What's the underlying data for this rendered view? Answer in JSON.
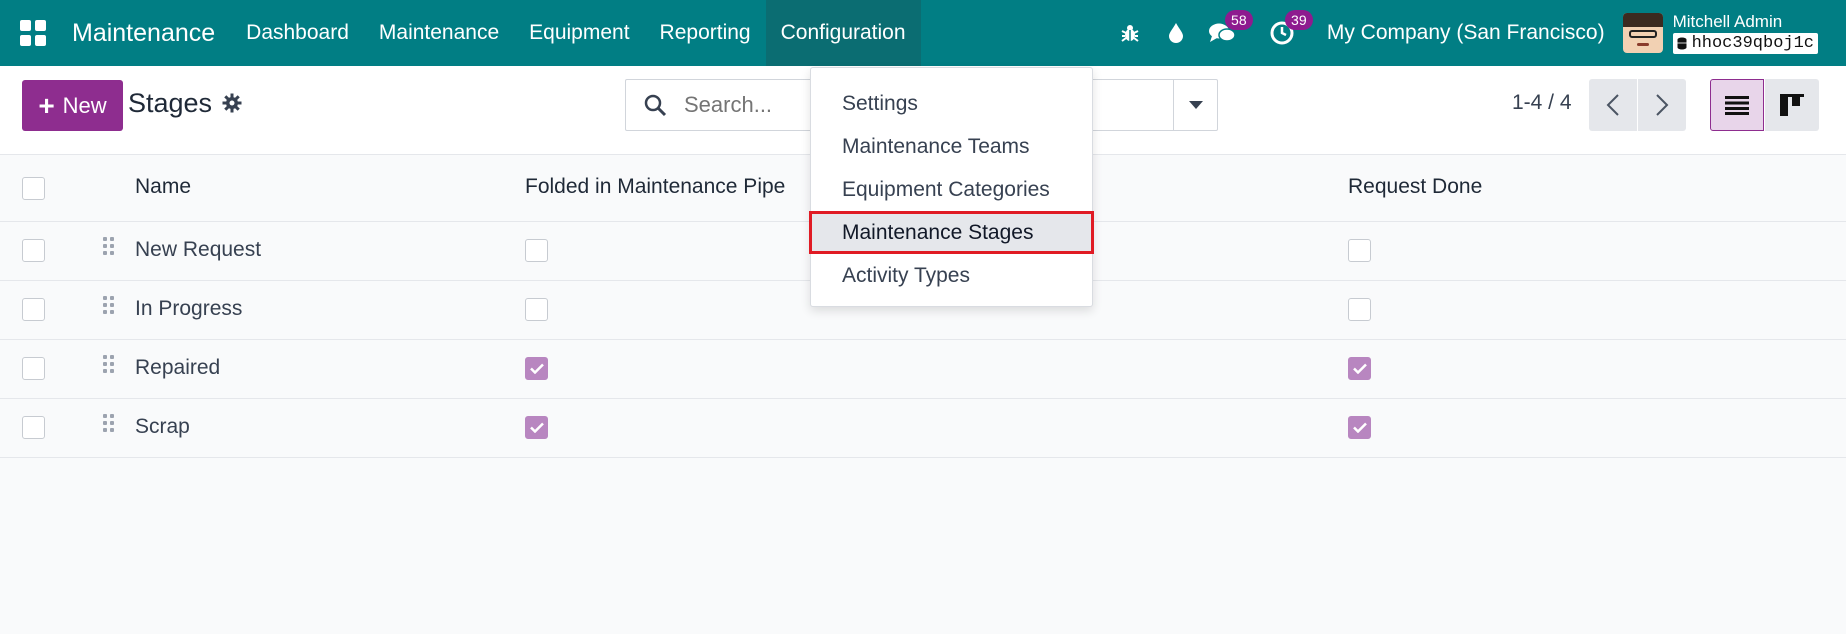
{
  "navbar": {
    "app_name": "Maintenance",
    "menu": [
      {
        "label": "Dashboard"
      },
      {
        "label": "Maintenance"
      },
      {
        "label": "Equipment"
      },
      {
        "label": "Reporting"
      },
      {
        "label": "Configuration"
      }
    ],
    "messages_badge": "58",
    "activities_badge": "39",
    "company": "My Company (San Francisco)",
    "user_name": "Mitchell Admin",
    "database": "hhoc39qboj1c",
    "colors": {
      "bar": "#017e84",
      "badge": "#8e1b8f"
    }
  },
  "control_panel": {
    "new_label": "New",
    "title": "Stages",
    "search_placeholder": "Search...",
    "pager": "1-4 / 4",
    "accent": "#8e2d8f"
  },
  "table": {
    "columns": [
      "Name",
      "Folded in Maintenance Pipe",
      "Request Done"
    ],
    "rows": [
      {
        "name": "New Request",
        "folded": false,
        "done": false
      },
      {
        "name": "In Progress",
        "folded": false,
        "done": false
      },
      {
        "name": "Repaired",
        "folded": true,
        "done": true
      },
      {
        "name": "Scrap",
        "folded": true,
        "done": true
      }
    ]
  },
  "config_menu": {
    "items": [
      {
        "label": "Settings"
      },
      {
        "label": "Maintenance Teams"
      },
      {
        "label": "Equipment Categories"
      },
      {
        "label": "Maintenance Stages",
        "highlighted": true
      },
      {
        "label": "Activity Types"
      }
    ]
  }
}
